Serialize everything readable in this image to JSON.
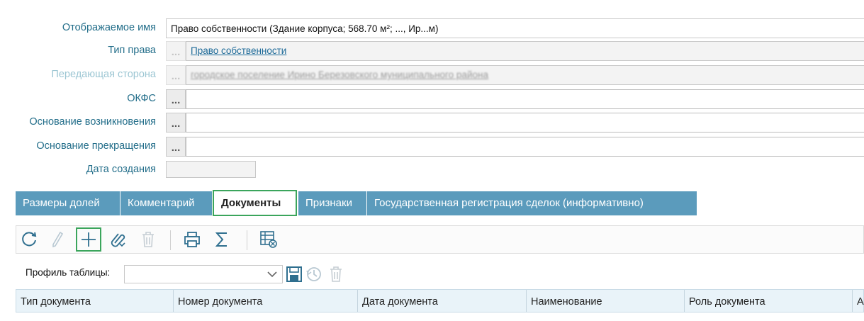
{
  "form": {
    "display_name": {
      "label": "Отображаемое имя",
      "value": "Право собственности (Здание корпуса; 568.70 м²; ..., Ир...м)"
    },
    "right_type": {
      "label": "Тип права",
      "value": "Право собственности"
    },
    "transferring_party": {
      "label": "Передающая сторона",
      "value": "городское поселение Ирино Березовского муниципального района"
    },
    "okfs": {
      "label": "ОКФС"
    },
    "basis_origin": {
      "label": "Основание возникновения"
    },
    "basis_termination": {
      "label": "Основание прекращения"
    },
    "creation_date": {
      "label": "Дата создания"
    },
    "ellipsis": "..."
  },
  "tabs": [
    {
      "label": "Размеры долей"
    },
    {
      "label": "Комментарий"
    },
    {
      "label": "Документы",
      "active": true
    },
    {
      "label": "Признаки"
    },
    {
      "label": "Государственная регистрация сделок (информативно)"
    }
  ],
  "toolbar": {
    "buttons": [
      "refresh-icon",
      "edit-icon",
      "add-icon",
      "attach-icon",
      "delete-icon",
      "print-icon",
      "sum-icon",
      "table-settings-icon"
    ]
  },
  "profile": {
    "label": "Профиль таблицы:",
    "value": ""
  },
  "grid": {
    "columns": [
      "Тип документа",
      "Номер документа",
      "Дата документа",
      "Наименование",
      "Роль документа",
      "А"
    ]
  },
  "colors": {
    "label": "#236e8a",
    "tab_bg": "#5b9bbc",
    "highlight": "#3ba55c",
    "grid_header_bg": "#e9f3f9"
  }
}
